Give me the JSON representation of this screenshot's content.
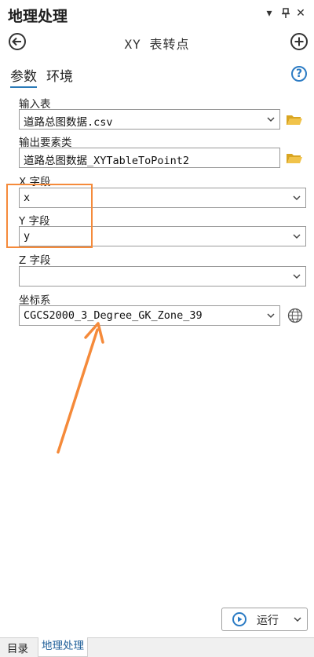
{
  "panel": {
    "title": "地理处理",
    "controls": {
      "menu": "▾",
      "pin": "⊥",
      "close": "✕"
    }
  },
  "tool": {
    "title": "XY 表转点",
    "back_icon": "back-arrow-icon",
    "add_icon": "add-icon"
  },
  "tabs": [
    {
      "label": "参数",
      "active": true
    },
    {
      "label": "环境",
      "active": false
    }
  ],
  "fields": {
    "input_table": {
      "label": "输入表",
      "value": "道路总图数据.csv"
    },
    "output_features": {
      "label": "输出要素类",
      "value": "道路总图数据_XYTableToPoint2"
    },
    "x_field": {
      "label": "X 字段",
      "value": "x"
    },
    "y_field": {
      "label": "Y 字段",
      "value": "y"
    },
    "z_field": {
      "label": "Z 字段",
      "value": ""
    },
    "coordinate_system": {
      "label": "坐标系",
      "value": "CGCS2000_3_Degree_GK_Zone_39"
    }
  },
  "run_button": {
    "label": "运行"
  },
  "bottom_tabs": [
    {
      "label": "目录",
      "active": false
    },
    {
      "label": "地理处理",
      "active": true
    }
  ],
  "colors": {
    "accent": "#2a7ab8",
    "annotation": "#f58a3a",
    "folder": "#e8b62c"
  }
}
